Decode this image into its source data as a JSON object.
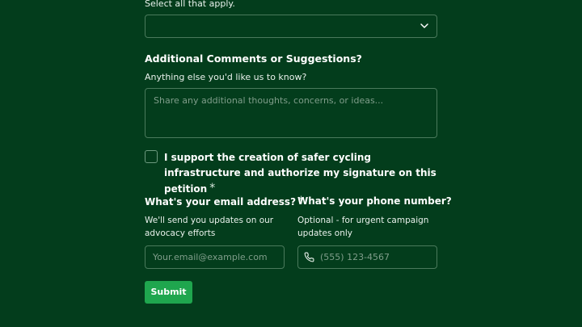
{
  "multiselect": {
    "hint": "Select all that apply.",
    "icon": "chevron-down-icon"
  },
  "comments": {
    "title": "Additional Comments or Suggestions?",
    "hint": "Anything else you'd like us to know?",
    "placeholder": "Share any additional thoughts, concerns, or ideas..."
  },
  "consent": {
    "label": "I support the creation of safer cycling infrastructure and authorize my signature on this petition",
    "required_mark": "*",
    "checked": false
  },
  "email": {
    "title": "What's your email address?",
    "required_mark": "*",
    "hint": "We'll send you updates on our advocacy efforts",
    "placeholder": "Your.email@example.com"
  },
  "phone": {
    "title": "What's your phone number?",
    "hint": "Optional - for urgent campaign updates only",
    "placeholder": "(555) 123-4567",
    "icon": "phone-icon"
  },
  "submit": {
    "label": "Submit"
  },
  "colors": {
    "background": "#033d1c",
    "accent": "#1fa64e",
    "border": "#4a7a5c"
  }
}
